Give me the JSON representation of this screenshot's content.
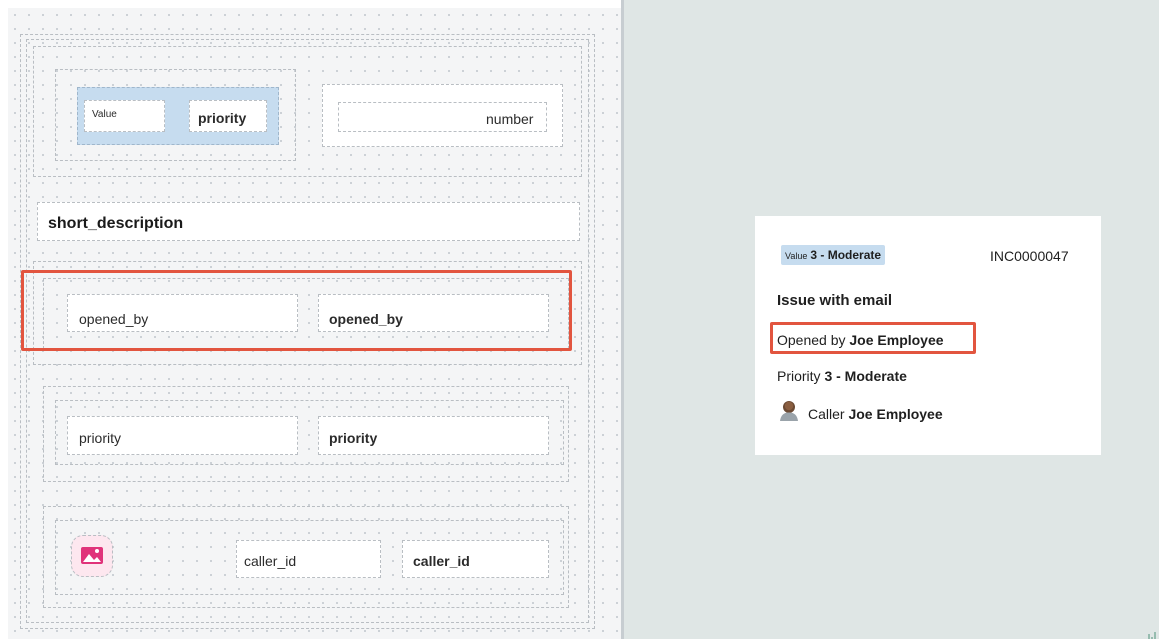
{
  "builder": {
    "header_row": {
      "value_label": "Value",
      "value_field": "priority",
      "number_field": "number"
    },
    "short_description_field": "short_description",
    "opened_by_row": {
      "label": "opened_by",
      "value": "opened_by"
    },
    "priority_row": {
      "label": "priority",
      "value": "priority"
    },
    "caller_row": {
      "image_icon": "image-placeholder-icon",
      "label": "caller_id",
      "value": "caller_id"
    }
  },
  "preview": {
    "value_badge": {
      "label": "Value",
      "value": "3 - Moderate"
    },
    "number": "INC0000047",
    "title": "Issue with email",
    "opened_by": {
      "label": "Opened by",
      "value": "Joe Employee"
    },
    "priority": {
      "label": "Priority",
      "value": "3 - Moderate"
    },
    "caller": {
      "label": "Caller",
      "value": "Joe Employee",
      "avatar_icon": "user-avatar-icon"
    }
  },
  "colors": {
    "highlight": "#e2553f",
    "value_badge_bg": "#c6dcef",
    "right_panel_bg": "#dfe6e5",
    "image_icon": "#e0337a"
  }
}
